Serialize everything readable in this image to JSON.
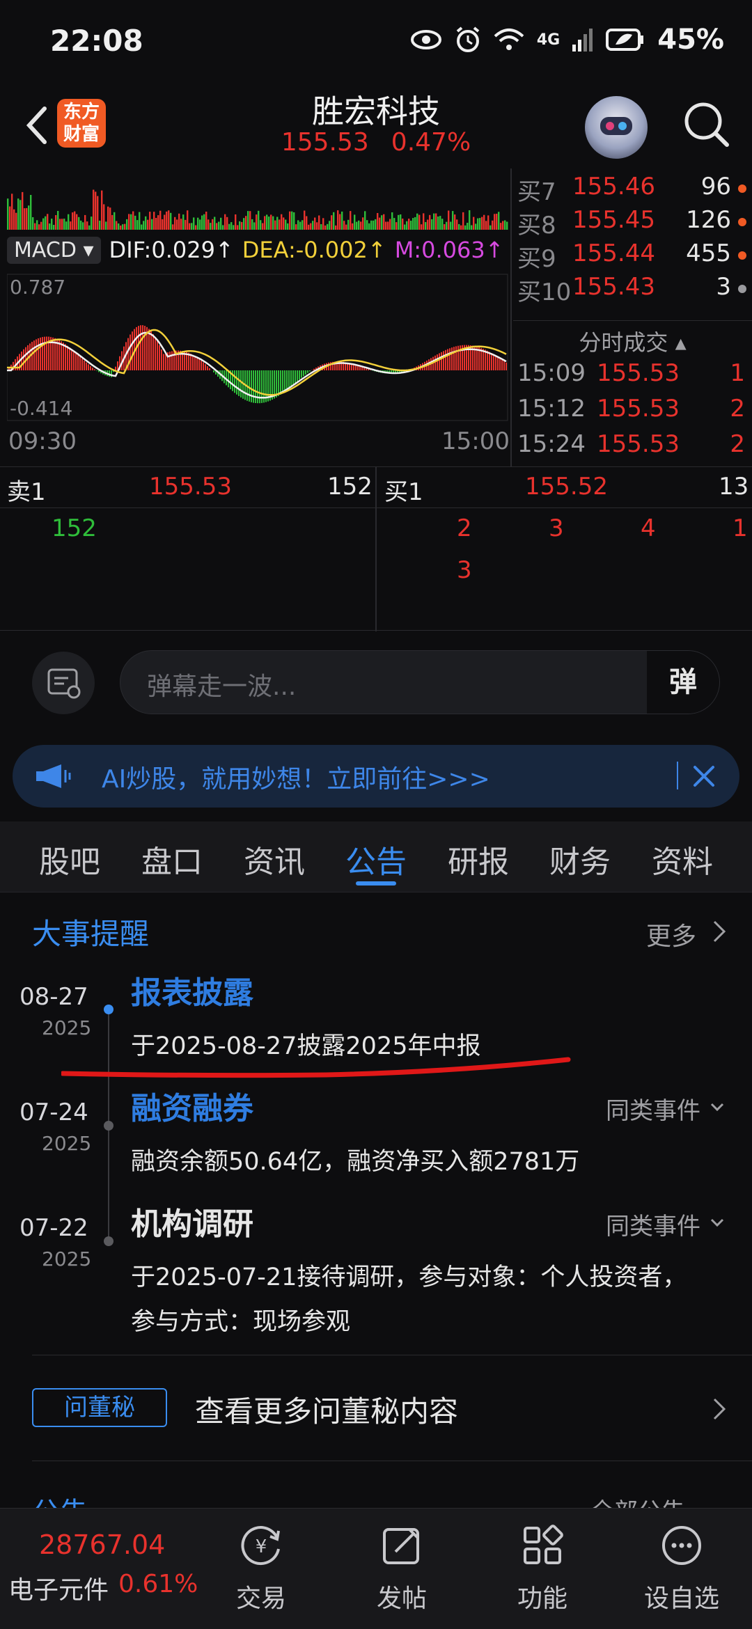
{
  "status_bar": {
    "time": "22:08",
    "network": "4G",
    "battery": "45%"
  },
  "header": {
    "logo_line1": "东方",
    "logo_line2": "财富",
    "title": "胜宏科技",
    "price": "155.53",
    "change_pct": "0.47%"
  },
  "chart": {
    "macd_label": "MACD",
    "dif": "DIF:0.029↑",
    "dea": "DEA:-0.002↑",
    "m": "M:0.063↑",
    "macd_max": "0.787",
    "macd_min": "-0.414",
    "time_start": "09:30",
    "time_end": "15:00"
  },
  "order_book": [
    {
      "label": "买7",
      "price": "155.46",
      "volume": "96"
    },
    {
      "label": "买8",
      "price": "155.45",
      "volume": "126"
    },
    {
      "label": "买9",
      "price": "155.44",
      "volume": "455"
    },
    {
      "label": "买10",
      "price": "155.43",
      "volume": "3"
    }
  ],
  "trades": {
    "header": "分时成交",
    "rows": [
      {
        "time": "15:09",
        "price": "155.53",
        "volume": "1"
      },
      {
        "time": "15:12",
        "price": "155.53",
        "volume": "2"
      },
      {
        "time": "15:24",
        "price": "155.53",
        "volume": "2"
      }
    ]
  },
  "queue": {
    "sell_label": "卖1",
    "sell_price": "155.53",
    "sell_total": "152",
    "sell_items": [
      "152"
    ],
    "buy_label": "买1",
    "buy_price": "155.52",
    "buy_total": "13",
    "buy_items": [
      "2",
      "3",
      "4",
      "1",
      "3"
    ]
  },
  "danmaku": {
    "placeholder": "弹幕走一波...",
    "send_label": "弹"
  },
  "ai_banner": {
    "text": "AI炒股，就用妙想！立即前往>>>"
  },
  "tabs": [
    "股吧",
    "盘口",
    "资讯",
    "公告",
    "研报",
    "财务",
    "资料"
  ],
  "active_tab": "公告",
  "events": {
    "title": "大事提醒",
    "more": "更多",
    "items": [
      {
        "date": "08-27",
        "year": "2025",
        "title": "报表披露",
        "desc": "于2025-08-27披露2025年中报",
        "similar": ""
      },
      {
        "date": "07-24",
        "year": "2025",
        "title": "融资融券",
        "desc": "融资余额50.64亿，融资净买入额2781万",
        "similar": "同类事件"
      },
      {
        "date": "07-22",
        "year": "2025",
        "title": "机构调研",
        "desc": "于2025-07-21接待调研，参与对象：个人投资者，",
        "desc2": "参与方式：现场参观",
        "similar": "同类事件"
      }
    ]
  },
  "qa": {
    "badge": "问董秘",
    "text": "查看更多问董秘内容"
  },
  "partial_section": {
    "left": "公告",
    "right": "全部公告"
  },
  "bottom_bar": {
    "index_value": "28767.04",
    "index_name": "电子元件",
    "index_pct": "0.61%",
    "items": [
      "交易",
      "发帖",
      "功能",
      "设自选"
    ]
  },
  "colors": {
    "up": "#e8322d",
    "down": "#2fbd3a",
    "accent": "#3a8df0"
  }
}
